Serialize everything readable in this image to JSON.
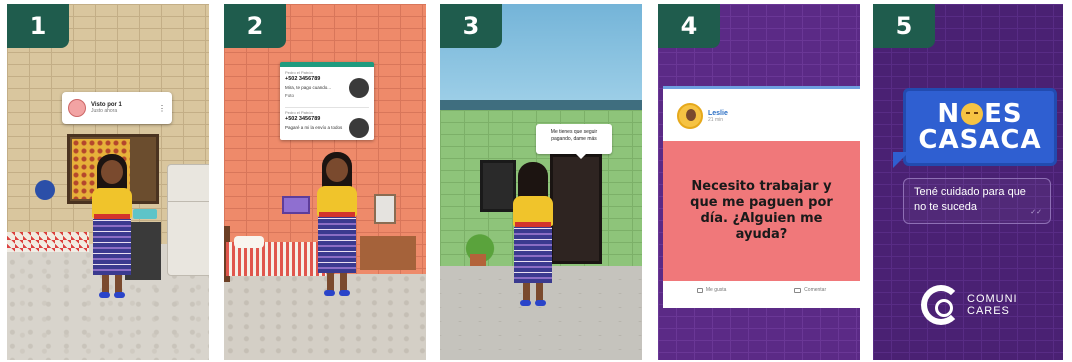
{
  "panels": [
    {
      "number": "1"
    },
    {
      "number": "2"
    },
    {
      "number": "3"
    },
    {
      "number": "4"
    },
    {
      "number": "5"
    }
  ],
  "panel1": {
    "notification": {
      "title": "Visto por 1",
      "subtitle": "Justo ahora"
    }
  },
  "panel2": {
    "chat": {
      "message1": {
        "name": "Pedro el Patrón",
        "phone": "+502 3456789",
        "text": "Mira, te pago cuando...",
        "attachment": "Foto"
      },
      "message2": {
        "name": "Pedro el Patrón",
        "phone": "+502 3456789",
        "text": "Pagaré a mi la envío a todos"
      }
    }
  },
  "panel3": {
    "speech": "Me tienes que seguir pagando, dame más"
  },
  "panel4": {
    "post": {
      "author": "Leslie",
      "time": "21 min",
      "text": "Necesito trabajar y que me paguen por día. ¿Alguien me ayuda?",
      "like_label": "Me gusta",
      "comment_label": "Comentar"
    },
    "colors": {
      "post_bg": "#f0787a",
      "author": "#2b6fc4"
    }
  },
  "panel5": {
    "slogan_line1_a": "N",
    "slogan_line1_b": "ES",
    "slogan_line2": "CASACA",
    "reply_text": "Tené cuidado para que no te suceda",
    "logo_line1": "COMUNI",
    "logo_line2": "CARES",
    "colors": {
      "slogan_bg": "#2f5fd1",
      "background": "#4a2173"
    }
  },
  "colors": {
    "badge": "#1f5c4d"
  }
}
